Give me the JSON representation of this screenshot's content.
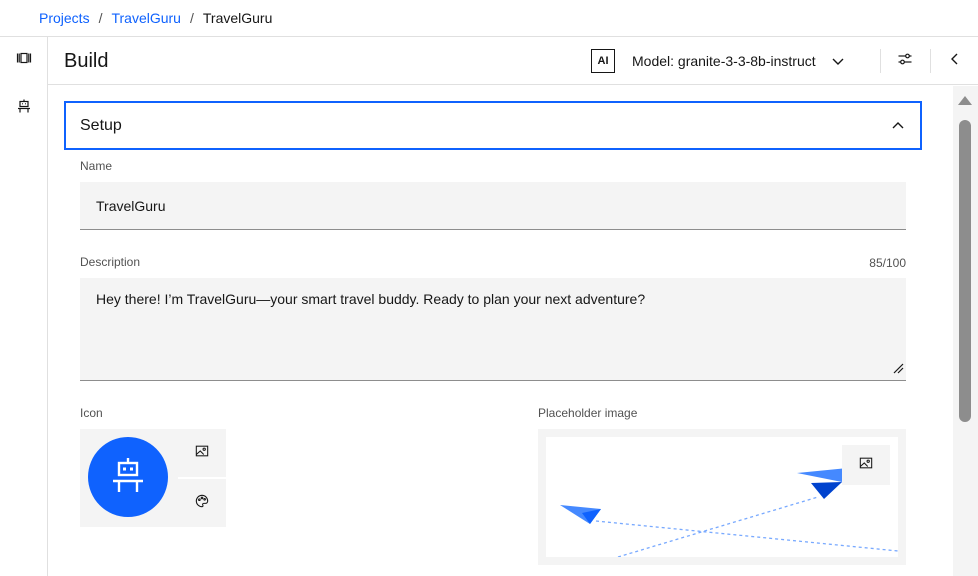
{
  "breadcrumb": {
    "items": [
      "Projects",
      "TravelGuru"
    ],
    "separator": "/",
    "current": "TravelGuru"
  },
  "leftrail": {
    "icons": [
      "agent-canvas-icon",
      "robot-icon"
    ]
  },
  "header": {
    "title": "Build",
    "ai_badge": "AI",
    "model_label": "Model: granite-3-3-8b-instruct",
    "icons": [
      "chevron-down-icon",
      "settings-sliders-icon",
      "chevron-left-icon"
    ]
  },
  "setup": {
    "title": "Setup",
    "expanded": true,
    "name": {
      "label": "Name",
      "value": "TravelGuru"
    },
    "description": {
      "label": "Description",
      "value": "Hey there! I’m TravelGuru—your smart travel buddy. Ready to plan your next adventure?",
      "counter": "85/100"
    },
    "icon": {
      "label": "Icon",
      "avatar_icon": "robot-icon",
      "actions": [
        "image-icon",
        "palette-icon"
      ]
    },
    "placeholder_image": {
      "label": "Placeholder image",
      "action_icon": "image-icon"
    }
  },
  "colors": {
    "accent": "#0f62fe",
    "field_bg": "#f4f4f4",
    "text": "#161616",
    "secondary_text": "#525252"
  }
}
